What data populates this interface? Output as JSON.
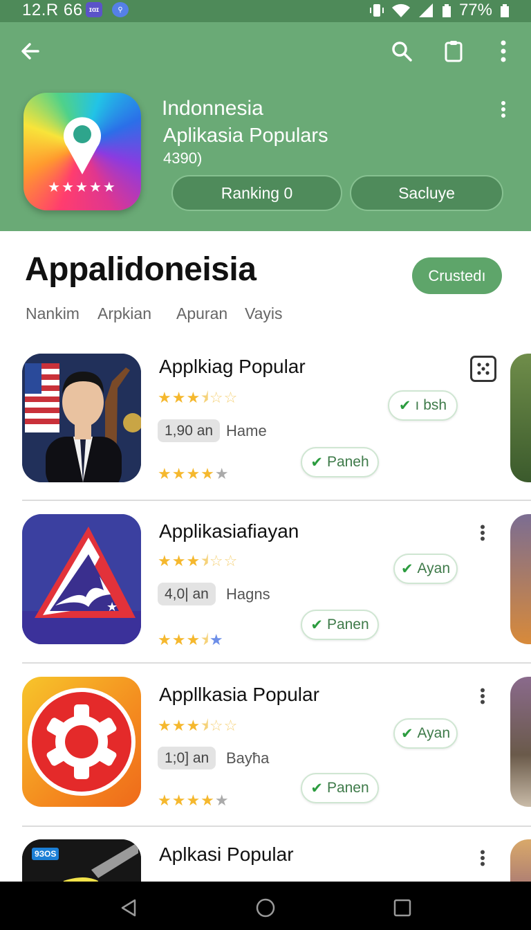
{
  "status_bar": {
    "time": "12.R 66",
    "sim1": "ɪɑɪ",
    "sim2": "⚲",
    "battery_text": "77%"
  },
  "header": {
    "title": "Indonnesia",
    "subtitle": "Aplikasia Populars",
    "count": "4390)",
    "ranking_button": "Ranking 0",
    "second_button": "Sacluye",
    "icons": [
      "back-arrow-icon",
      "search-icon",
      "clipboard-icon",
      "more-vert-icon"
    ],
    "colors": {
      "bar": "#6aaa76",
      "button": "#4f8b5b"
    }
  },
  "section": {
    "title": "Appalidoneisia",
    "action_button": "Crustedı",
    "tabs": [
      "Nankim",
      "Arpkian",
      "Apuran",
      "Vayis"
    ]
  },
  "apps": [
    {
      "name": "Applkiag Popular",
      "size": "1,90 an",
      "category": "Hame",
      "chip1": "ı bsh",
      "chip2": "Paneh",
      "rating1": 3.5,
      "rating2": 4
    },
    {
      "name": "Applikasiafiayan",
      "size": "4,0| an",
      "category": "Hagns",
      "chip1": "Ayan",
      "chip2": "Panen",
      "rating1": 3.5,
      "rating2": 4
    },
    {
      "name": "Appllkasia Popular",
      "size": "1;0] an",
      "category": "Bayħa",
      "chip1": "Ayan",
      "chip2": "Panen",
      "rating1": 3.5,
      "rating2": 4
    },
    {
      "name": "Aplkasi Popular"
    }
  ],
  "thumb_badge": "9ЗОS"
}
